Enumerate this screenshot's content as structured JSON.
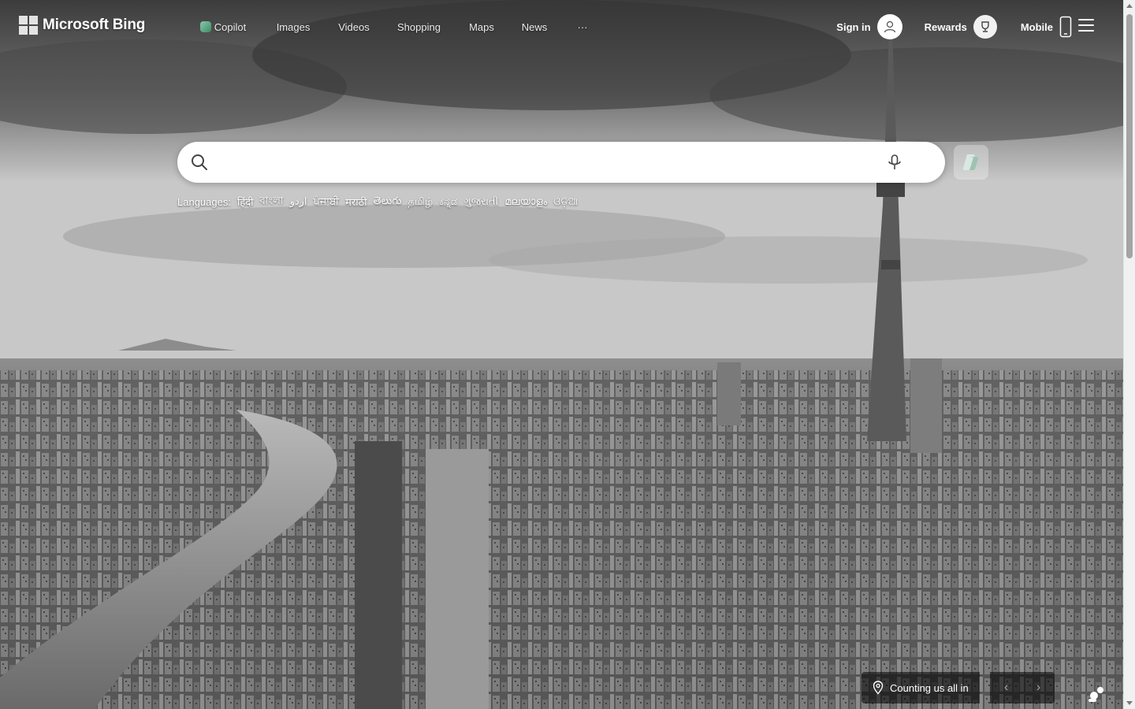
{
  "brand": {
    "name": "Microsoft Bing"
  },
  "nav": {
    "items": [
      {
        "label": "Copilot"
      },
      {
        "label": "Images"
      },
      {
        "label": "Videos"
      },
      {
        "label": "Shopping"
      },
      {
        "label": "Maps"
      },
      {
        "label": "News"
      },
      {
        "label": "···"
      }
    ]
  },
  "header": {
    "signin_label": "Sign in",
    "rewards_label": "Rewards",
    "mobile_label": "Mobile"
  },
  "search": {
    "value": "",
    "placeholder": ""
  },
  "languages": {
    "label": "Languages:",
    "items": [
      "हिंदी",
      "বাংলা",
      "اردو",
      "ਪੰਜਾਬੀ",
      "मराठी",
      "తెలుగు",
      "தமிழ்",
      "ಕನ್ನಡ",
      "ગુજરાતી",
      "മലയാളം",
      "ଓଡ଼ିଆ"
    ]
  },
  "background": {
    "location_label": "Counting us all in"
  },
  "pager": {
    "prev": "‹",
    "next": "›"
  },
  "colors": {
    "search_bg": "#ffffff",
    "overlay": "#000000",
    "text": "#ffffff"
  }
}
